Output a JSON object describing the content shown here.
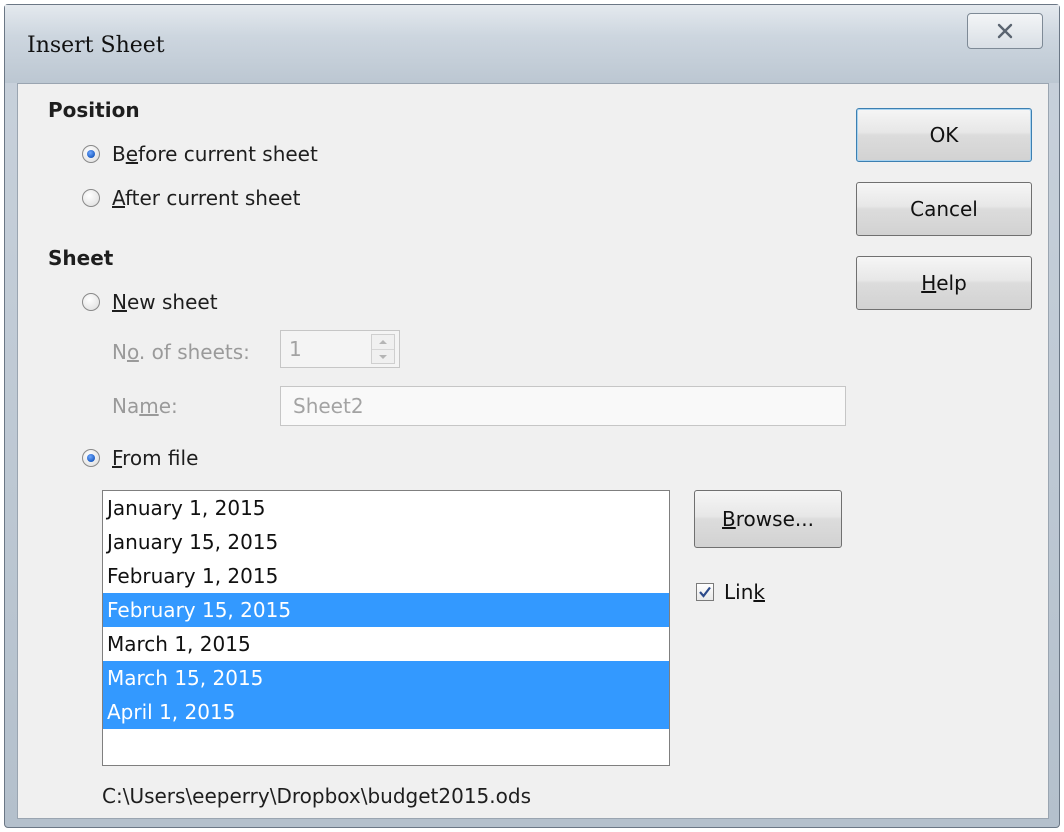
{
  "window": {
    "title": "Insert Sheet"
  },
  "position": {
    "heading": "Position",
    "before": {
      "pre": "B",
      "key": "e",
      "post": "fore current sheet",
      "checked": true
    },
    "after": {
      "pre": "",
      "key": "A",
      "post": "fter current sheet",
      "checked": false
    }
  },
  "sheet": {
    "heading": "Sheet",
    "new_sheet": {
      "pre": "",
      "key": "N",
      "post": "ew sheet",
      "checked": false
    },
    "no_of_sheets": {
      "pre": "N",
      "key": "o",
      "post": ". of sheets:",
      "value": "1"
    },
    "name": {
      "pre": "Na",
      "key": "m",
      "post": "e:",
      "value": "Sheet2"
    },
    "from_file": {
      "pre": "",
      "key": "F",
      "post": "rom file",
      "checked": true
    },
    "file_sheets": [
      {
        "label": "January 1, 2015",
        "selected": false
      },
      {
        "label": "January 15, 2015",
        "selected": false
      },
      {
        "label": "February 1, 2015",
        "selected": false
      },
      {
        "label": "February 15, 2015",
        "selected": true
      },
      {
        "label": "March 1, 2015",
        "selected": false
      },
      {
        "label": "March 15, 2015",
        "selected": true
      },
      {
        "label": "April 1, 2015",
        "selected": true
      }
    ],
    "browse": {
      "pre": "",
      "key": "B",
      "post": "rowse..."
    },
    "link": {
      "pre": "Lin",
      "key": "k",
      "post": "",
      "checked": true
    },
    "file_path": "C:\\Users\\eeperry\\Dropbox\\budget2015.ods"
  },
  "buttons": {
    "ok": "OK",
    "cancel": "Cancel",
    "help": {
      "pre": "",
      "key": "H",
      "post": "elp"
    }
  },
  "colors": {
    "selection": "#3399ff",
    "accent": "#1f5fc4"
  }
}
